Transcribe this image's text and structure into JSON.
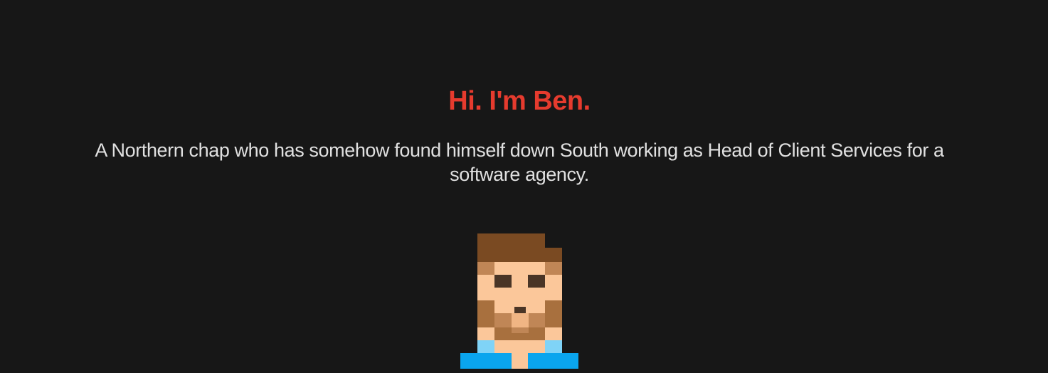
{
  "hero": {
    "title": "Hi. I'm Ben.",
    "intro": "A Northern chap who has somehow found himself down South working as Head of Client Services for a software agency."
  },
  "avatar": {
    "icon": "pixel-avatar-icon",
    "colors": {
      "hair": "#7a4a22",
      "beard": "#a8703e",
      "beard_light": "#c08656",
      "skin": "#fbc79a",
      "skin_shadow": "#f0b584",
      "eyes": "#4a3526",
      "shirt_light": "#7fd3f7",
      "shirt": "#0aa5ee"
    }
  },
  "theme": {
    "background": "#171717",
    "accent": "#e63b2e",
    "text": "#e0e0e0"
  }
}
